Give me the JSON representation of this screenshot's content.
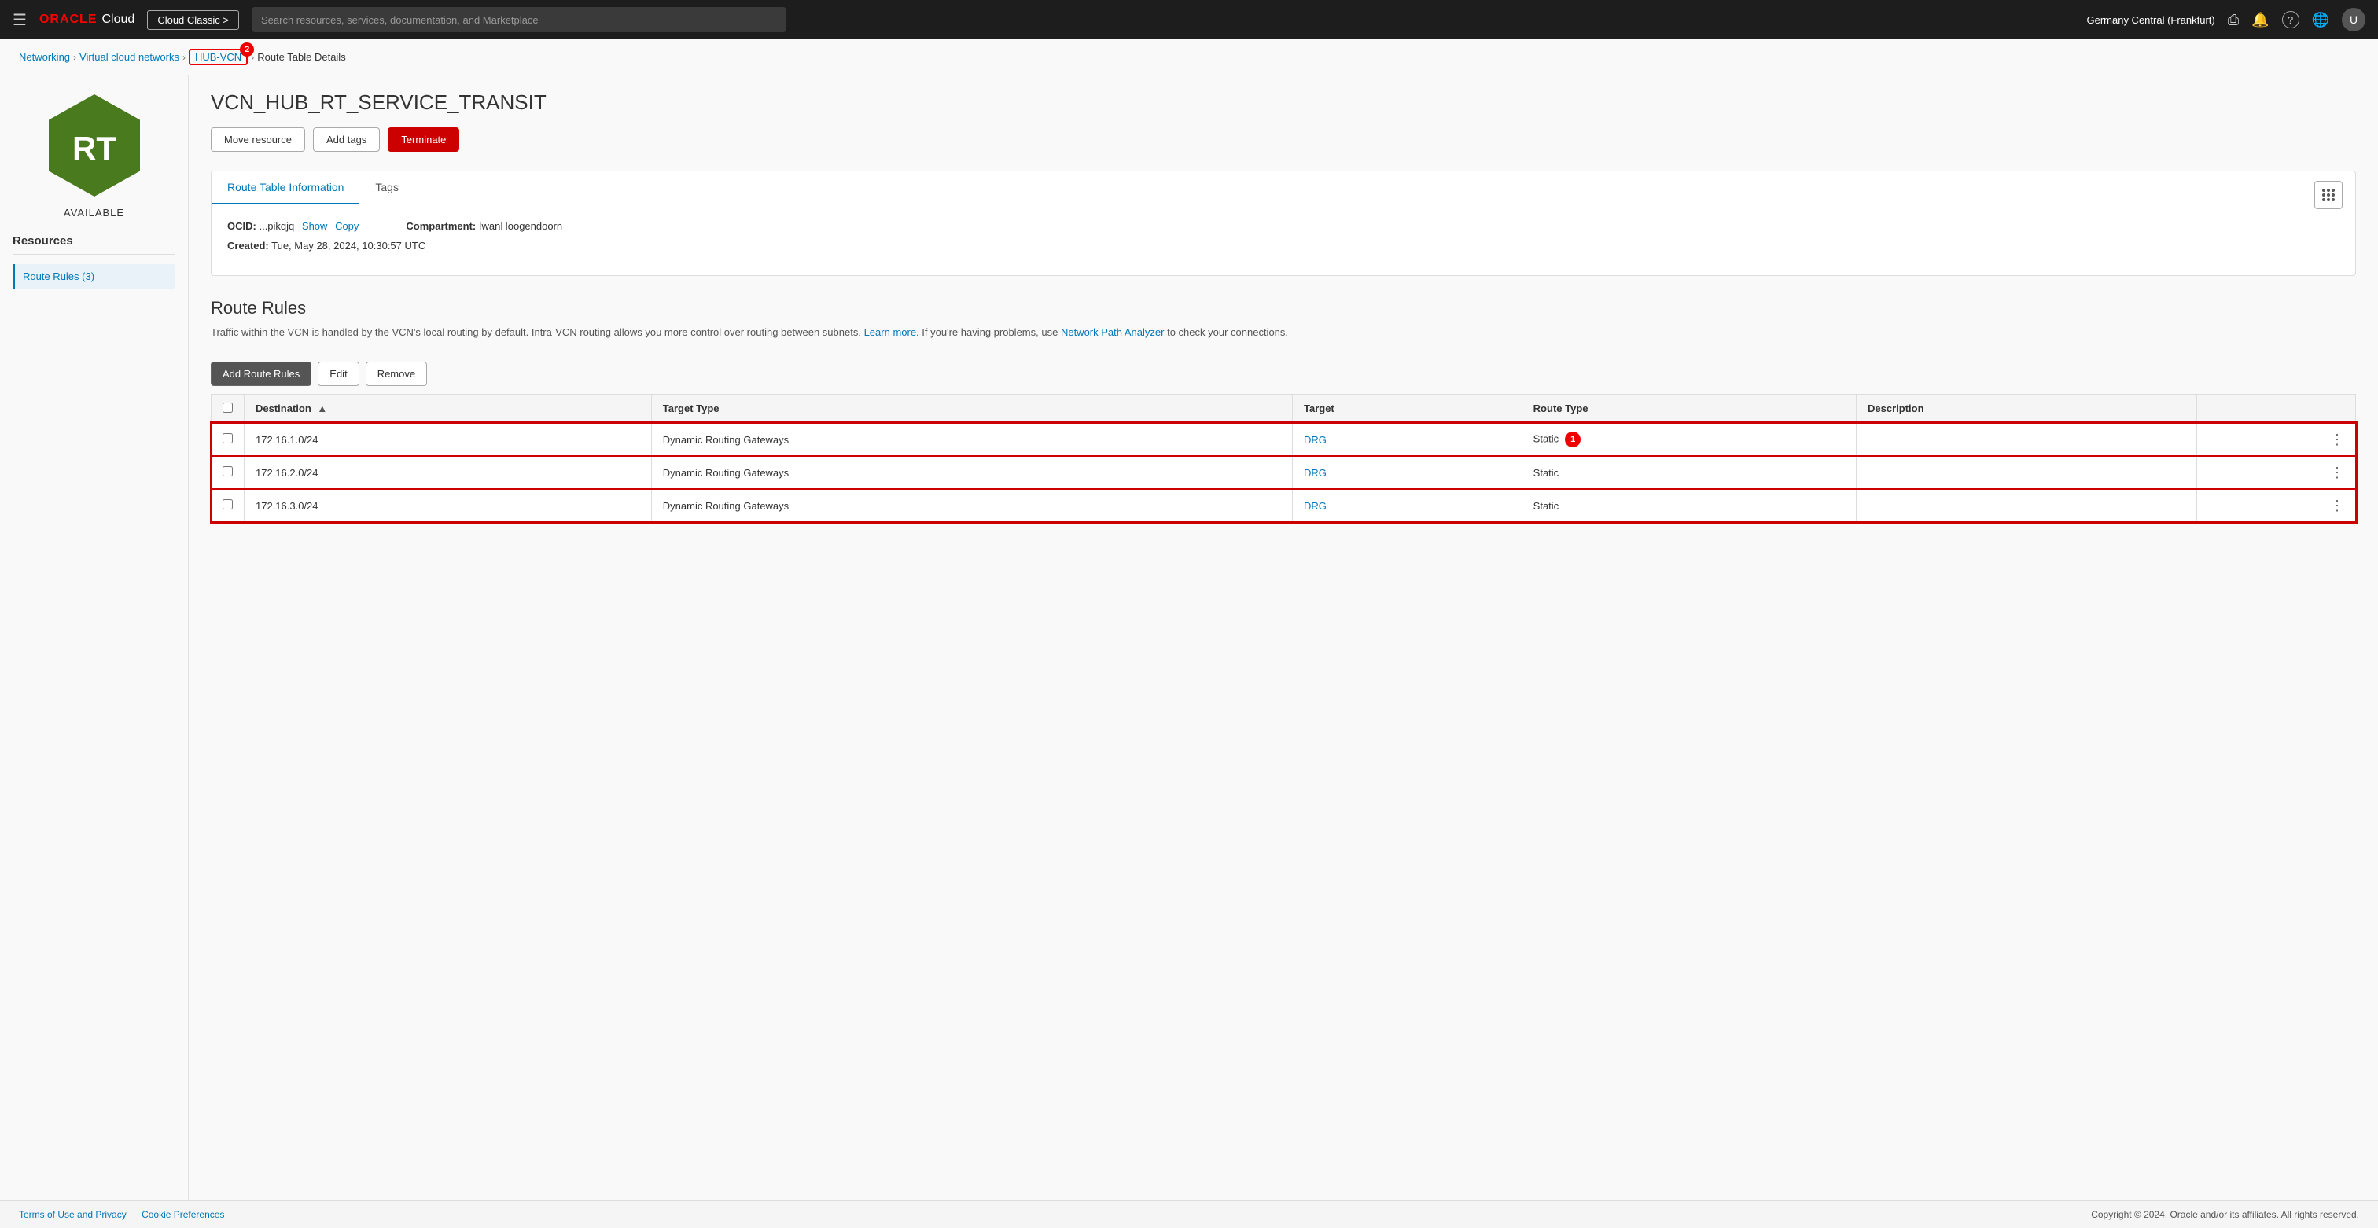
{
  "nav": {
    "hamburger_icon": "☰",
    "logo_oracle": "ORACLE",
    "logo_cloud": "Cloud",
    "cloud_classic_label": "Cloud Classic >",
    "search_placeholder": "Search resources, services, documentation, and Marketplace",
    "region": "Germany Central (Frankfurt)",
    "region_icon": "▾",
    "console_icon": "[>_]",
    "bell_icon": "🔔",
    "help_icon": "?",
    "globe_icon": "🌐",
    "avatar_label": "U"
  },
  "breadcrumb": {
    "networking": "Networking",
    "vcn_label": "Virtual cloud networks",
    "hub_vcn": "HUB-VCN",
    "hub_vcn_badge": "2",
    "current": "Route Table Details"
  },
  "left_panel": {
    "rt_text": "RT",
    "status": "AVAILABLE",
    "resources_title": "Resources",
    "nav_item": "Route Rules (3)"
  },
  "page": {
    "title": "VCN_HUB_RT_SERVICE_TRANSIT",
    "btn_move": "Move resource",
    "btn_tags": "Add tags",
    "btn_terminate": "Terminate"
  },
  "info_card": {
    "tab_info": "Route Table Information",
    "tab_tags": "Tags",
    "ocid_label": "OCID:",
    "ocid_value": "...pikqjq",
    "ocid_show": "Show",
    "ocid_copy": "Copy",
    "compartment_label": "Compartment:",
    "compartment_value": "IwanHoogendoorn",
    "created_label": "Created:",
    "created_value": "Tue, May 28, 2024, 10:30:57 UTC"
  },
  "route_rules": {
    "section_title": "Route Rules",
    "description_main": "Traffic within the VCN is handled by the VCN's local routing by default. Intra-VCN routing allows you more control over routing between subnets.",
    "learn_more": "Learn more.",
    "description_end": "If you're having problems, use",
    "network_path": "Network Path Analyzer",
    "description_tail": "to check your connections.",
    "btn_add": "Add Route Rules",
    "btn_edit": "Edit",
    "btn_remove": "Remove",
    "col_checkbox": "",
    "col_destination": "Destination",
    "col_target_type": "Target Type",
    "col_target": "Target",
    "col_route_type": "Route Type",
    "col_description": "Description",
    "row1_badge": "1",
    "rows": [
      {
        "destination": "172.16.1.0/24",
        "target_type": "Dynamic Routing Gateways",
        "target": "DRG",
        "route_type": "Static",
        "description": "",
        "highlighted": true
      },
      {
        "destination": "172.16.2.0/24",
        "target_type": "Dynamic Routing Gateways",
        "target": "DRG",
        "route_type": "Static",
        "description": "",
        "highlighted": true
      },
      {
        "destination": "172.16.3.0/24",
        "target_type": "Dynamic Routing Gateways",
        "target": "DRG",
        "route_type": "Static",
        "description": "",
        "highlighted": true
      }
    ]
  },
  "footer": {
    "terms": "Terms of Use and Privacy",
    "cookies": "Cookie Preferences",
    "copyright": "Copyright © 2024, Oracle and/or its affiliates. All rights reserved."
  }
}
